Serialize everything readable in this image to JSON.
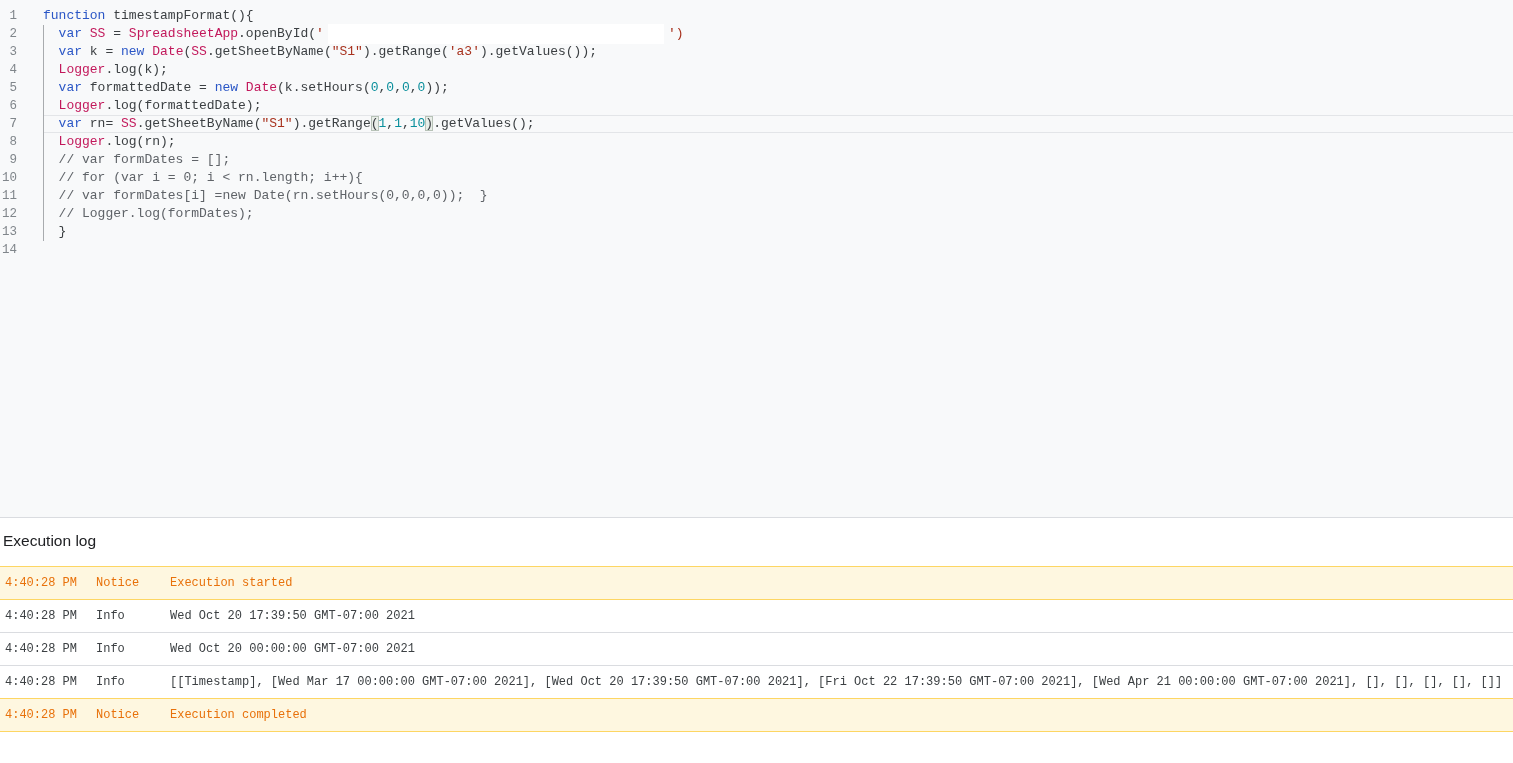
{
  "editor": {
    "lines": [
      {
        "number": "1",
        "current": false,
        "tokens": [
          {
            "kind": "keyword",
            "text": "function"
          },
          {
            "kind": "plain",
            "text": " timestampFormat(){"
          }
        ],
        "children": [
          {
            "number": "2",
            "current": false,
            "tokens": [
              {
                "kind": "keyword",
                "text": "var "
              },
              {
                "kind": "identifier",
                "text": "SS"
              },
              {
                "kind": "plain",
                "text": " = "
              },
              {
                "kind": "identifier",
                "text": "SpreadsheetApp"
              },
              {
                "kind": "plain",
                "text": ".openById("
              },
              {
                "kind": "string",
                "text": "'"
              },
              {
                "kind": "redacted"
              },
              {
                "kind": "string",
                "text": "'"
              },
              {
                "kind": "string",
                "text": ")"
              }
            ]
          },
          {
            "number": "3",
            "current": false,
            "tokens": [
              {
                "kind": "keyword",
                "text": "var"
              },
              {
                "kind": "plain",
                "text": " k = "
              },
              {
                "kind": "keyword",
                "text": "new "
              },
              {
                "kind": "identifier",
                "text": "Date"
              },
              {
                "kind": "plain",
                "text": "("
              },
              {
                "kind": "identifier",
                "text": "SS"
              },
              {
                "kind": "plain",
                "text": ".getSheetByName("
              },
              {
                "kind": "string",
                "text": "\"S1\""
              },
              {
                "kind": "plain",
                "text": ").getRange("
              },
              {
                "kind": "string",
                "text": "'a3'"
              },
              {
                "kind": "plain",
                "text": ").getValues());"
              }
            ]
          },
          {
            "number": "4",
            "current": false,
            "tokens": [
              {
                "kind": "identifier",
                "text": "Logger"
              },
              {
                "kind": "plain",
                "text": ".log(k);"
              }
            ]
          },
          {
            "number": "5",
            "current": false,
            "tokens": [
              {
                "kind": "keyword",
                "text": "var"
              },
              {
                "kind": "plain",
                "text": " formattedDate = "
              },
              {
                "kind": "keyword",
                "text": "new "
              },
              {
                "kind": "identifier",
                "text": "Date"
              },
              {
                "kind": "plain",
                "text": "(k.setHours("
              },
              {
                "kind": "number",
                "text": "0"
              },
              {
                "kind": "plain",
                "text": ","
              },
              {
                "kind": "number",
                "text": "0"
              },
              {
                "kind": "plain",
                "text": ","
              },
              {
                "kind": "number",
                "text": "0"
              },
              {
                "kind": "plain",
                "text": ","
              },
              {
                "kind": "number",
                "text": "0"
              },
              {
                "kind": "plain",
                "text": "));"
              }
            ]
          },
          {
            "number": "6",
            "current": false,
            "tokens": [
              {
                "kind": "identifier",
                "text": "Logger"
              },
              {
                "kind": "plain",
                "text": ".log(formattedDate);"
              }
            ]
          },
          {
            "number": "7",
            "current": true,
            "tokens": [
              {
                "kind": "keyword",
                "text": "var"
              },
              {
                "kind": "plain",
                "text": " rn= "
              },
              {
                "kind": "identifier",
                "text": "SS"
              },
              {
                "kind": "plain",
                "text": ".getSheetByName("
              },
              {
                "kind": "string",
                "text": "\"S1\""
              },
              {
                "kind": "plain",
                "text": ").getRange"
              },
              {
                "kind": "bracket",
                "text": "("
              },
              {
                "kind": "number",
                "text": "1"
              },
              {
                "kind": "plain",
                "text": ","
              },
              {
                "kind": "number",
                "text": "1"
              },
              {
                "kind": "plain",
                "text": ","
              },
              {
                "kind": "number",
                "text": "10"
              },
              {
                "kind": "bracket",
                "text": ")"
              },
              {
                "kind": "plain",
                "text": ".getValues();"
              }
            ]
          },
          {
            "number": "8",
            "current": false,
            "tokens": [
              {
                "kind": "identifier",
                "text": "Logger"
              },
              {
                "kind": "plain",
                "text": ".log(rn);"
              }
            ]
          },
          {
            "number": "9",
            "current": false,
            "tokens": [
              {
                "kind": "comment",
                "text": "// var formDates = [];"
              }
            ]
          },
          {
            "number": "10",
            "current": false,
            "tokens": [
              {
                "kind": "comment",
                "text": "// for (var i = 0; i < rn.length; i++){"
              }
            ]
          },
          {
            "number": "11",
            "current": false,
            "tokens": [
              {
                "kind": "comment",
                "text": "// var formDates[i] =new Date(rn.setHours(0,0,0,0));  }"
              }
            ]
          },
          {
            "number": "12",
            "current": false,
            "tokens": [
              {
                "kind": "comment",
                "text": "// Logger.log(formDates);"
              }
            ]
          },
          {
            "number": "13",
            "current": false,
            "tokens": [
              {
                "kind": "plain",
                "text": "}"
              }
            ]
          }
        ]
      },
      {
        "number": "14",
        "current": false
      }
    ]
  },
  "execution_log": {
    "title": "Execution log",
    "entries": [
      {
        "time": "4:40:28 PM",
        "kind": "notice",
        "severity": "Notice",
        "message": "Execution started"
      },
      {
        "time": "4:40:28 PM",
        "kind": "info",
        "severity": "Info",
        "message": "Wed Oct 20 17:39:50 GMT-07:00 2021"
      },
      {
        "time": "4:40:28 PM",
        "kind": "info",
        "severity": "Info",
        "message": "Wed Oct 20 00:00:00 GMT-07:00 2021"
      },
      {
        "time": "4:40:28 PM",
        "kind": "info",
        "severity": "Info",
        "message": "[[Timestamp], [Wed Mar 17 00:00:00 GMT-07:00 2021], [Wed Oct 20 17:39:50 GMT-07:00 2021], [Fri Oct 22 17:39:50 GMT-07:00 2021], [Wed Apr 21 00:00:00 GMT-07:00 2021], [], [], [], [], []]"
      },
      {
        "time": "4:40:28 PM",
        "kind": "notice",
        "severity": "Notice",
        "message": "Execution completed"
      }
    ]
  }
}
